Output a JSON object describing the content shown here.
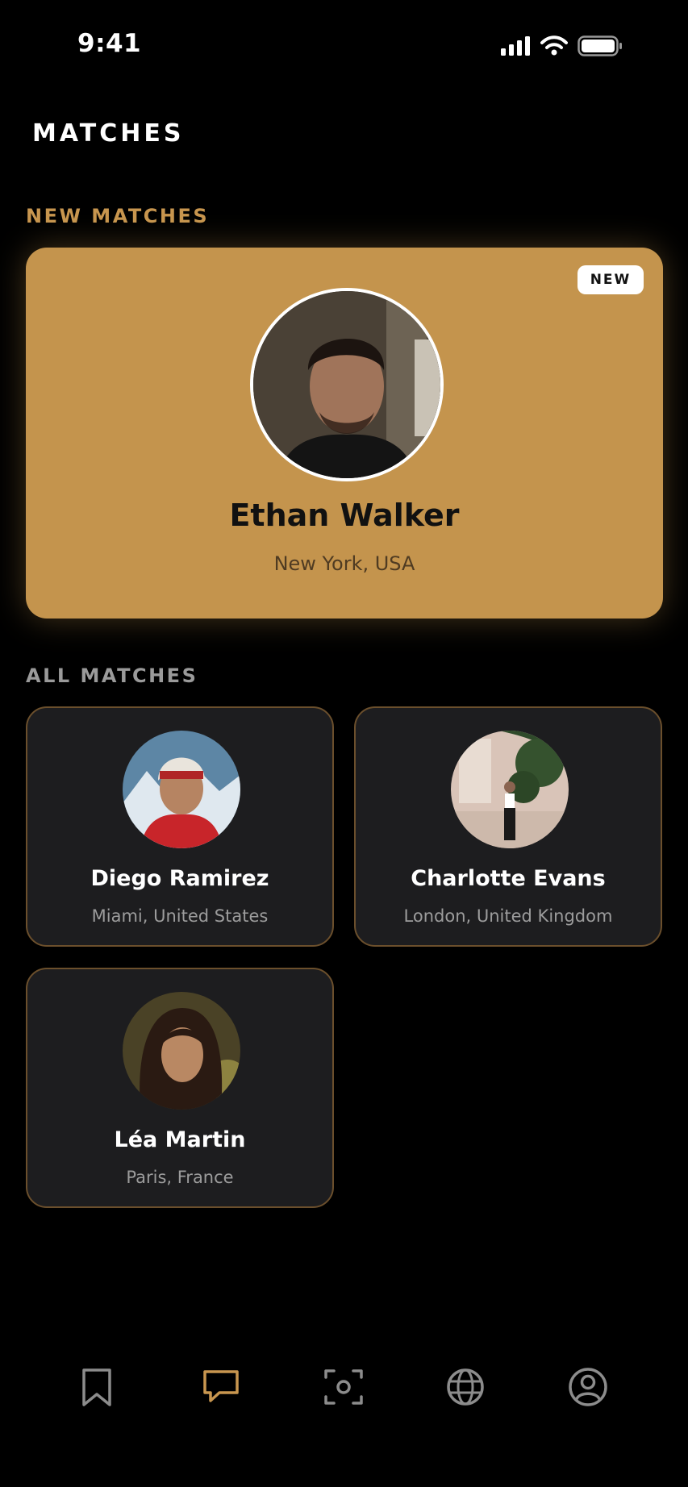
{
  "status_bar": {
    "time": "9:41"
  },
  "header": {
    "title": "MATCHES"
  },
  "sections": {
    "new_matches": "NEW MATCHES",
    "all_matches": "ALL MATCHES"
  },
  "featured_match": {
    "badge": "NEW",
    "name": "Ethan Walker",
    "location": "New York, USA"
  },
  "matches": [
    {
      "name": "Diego Ramirez",
      "location": "Miami, United States"
    },
    {
      "name": "Charlotte Evans",
      "location": "London, United Kingdom"
    },
    {
      "name": "Léa Martin",
      "location": "Paris, France"
    }
  ],
  "bottom_nav": [
    {
      "icon": "bookmark-icon",
      "active": false
    },
    {
      "icon": "chat-icon",
      "active": true
    },
    {
      "icon": "scan-icon",
      "active": false
    },
    {
      "icon": "globe-icon",
      "active": false
    },
    {
      "icon": "profile-icon",
      "active": false
    }
  ],
  "colors": {
    "background": "#000000",
    "accent": "#c8964f",
    "featured_card": "#c4944d",
    "card": "#1d1d1f",
    "card_border": "#6b4f2c"
  }
}
